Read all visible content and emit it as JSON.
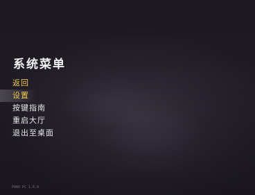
{
  "menu": {
    "title": "系统菜单",
    "items": [
      {
        "label": "返回",
        "state": "highlighted"
      },
      {
        "label": "设置",
        "state": "selected"
      },
      {
        "label": "按键指南",
        "state": "normal"
      },
      {
        "label": "重启大厅",
        "state": "normal"
      },
      {
        "label": "退出至桌面",
        "state": "normal"
      }
    ]
  },
  "footer": {
    "version": "PANO PC 1.0.0"
  },
  "colors": {
    "accent": "#f2c94c",
    "text": "#e8e8e8",
    "background": "#231f28"
  }
}
